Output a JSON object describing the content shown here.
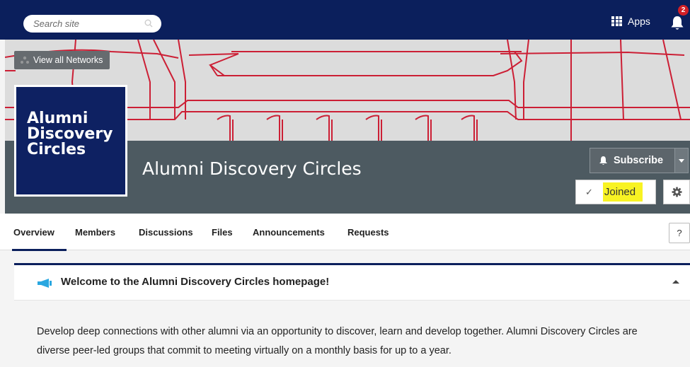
{
  "topbar": {
    "search_placeholder": "Search site",
    "apps_label": "Apps",
    "notification_count": "2",
    "bg_color": "#0b1f5c"
  },
  "banner": {
    "view_all_label": "View all Networks",
    "logo_text": "Alumni\nDiscovery\nCircles",
    "title": "Alumni Discovery Circles",
    "subscribe_label": "Subscribe",
    "joined_label": "Joined",
    "pattern_color": "#cc1f35"
  },
  "tabs": [
    {
      "label": "Overview",
      "active": true
    },
    {
      "label": "Members"
    },
    {
      "label": "Discussions"
    },
    {
      "label": "Files"
    },
    {
      "label": "Announcements"
    },
    {
      "label": "Requests"
    }
  ],
  "help_label": "?",
  "welcome": {
    "title": "Welcome to the Alumni Discovery Circles homepage!",
    "body": "Develop deep connections with other alumni via an opportunity to discover, learn and develop together. Alumni Discovery Circles are diverse peer-led groups that commit to meeting virtually on a monthly basis for up to a year."
  }
}
